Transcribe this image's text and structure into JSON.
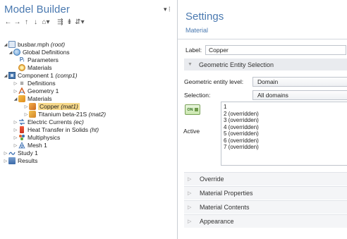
{
  "model_builder": {
    "title": "Model Builder",
    "title_controls": "▾ ⁞",
    "toolbar": [
      "←",
      "→",
      "↑",
      "↓",
      "⌂▾",
      "",
      "⇶",
      "⇟",
      "⇵▾"
    ],
    "tree": [
      {
        "label": "busbar.mph",
        "tag": "(root)"
      },
      {
        "label": "Global Definitions",
        "tag": ""
      },
      {
        "label": "Parameters",
        "tag": ""
      },
      {
        "label": "Materials",
        "tag": ""
      },
      {
        "label": "Component 1",
        "tag": "(comp1)"
      },
      {
        "label": "Definitions",
        "tag": ""
      },
      {
        "label": "Geometry 1",
        "tag": ""
      },
      {
        "label": "Materials",
        "tag": ""
      },
      {
        "label": "Copper",
        "tag": "(mat1)"
      },
      {
        "label": "Titanium beta-21S",
        "tag": "(mat2)"
      },
      {
        "label": "Electric Currents",
        "tag": "(ec)"
      },
      {
        "label": "Heat Transfer in Solids",
        "tag": "(ht)"
      },
      {
        "label": "Multiphysics",
        "tag": ""
      },
      {
        "label": "Mesh 1",
        "tag": ""
      },
      {
        "label": "Study 1",
        "tag": ""
      },
      {
        "label": "Results",
        "tag": ""
      }
    ]
  },
  "settings": {
    "title": "Settings",
    "subtitle": "Material",
    "label_key": "Label:",
    "label_value": "Copper",
    "geometric_section": "Geometric Entity Selection",
    "entity_level_key": "Geometric entity level:",
    "entity_level_value": "Domain",
    "selection_key": "Selection:",
    "selection_value": "All domains",
    "active_on": "ON",
    "active_label": "Active",
    "selection_list": [
      "1",
      "2 (overridden)",
      "3 (overridden)",
      "4 (overridden)",
      "5 (overridden)",
      "6 (overridden)",
      "7 (overridden)"
    ],
    "collapsed_sections": [
      "Override",
      "Material Properties",
      "Material Contents",
      "Appearance"
    ]
  },
  "colors": {
    "accent": "#4a79b0",
    "selected_highlight": "#f7d98a",
    "section_bg": "#e9ebef"
  }
}
